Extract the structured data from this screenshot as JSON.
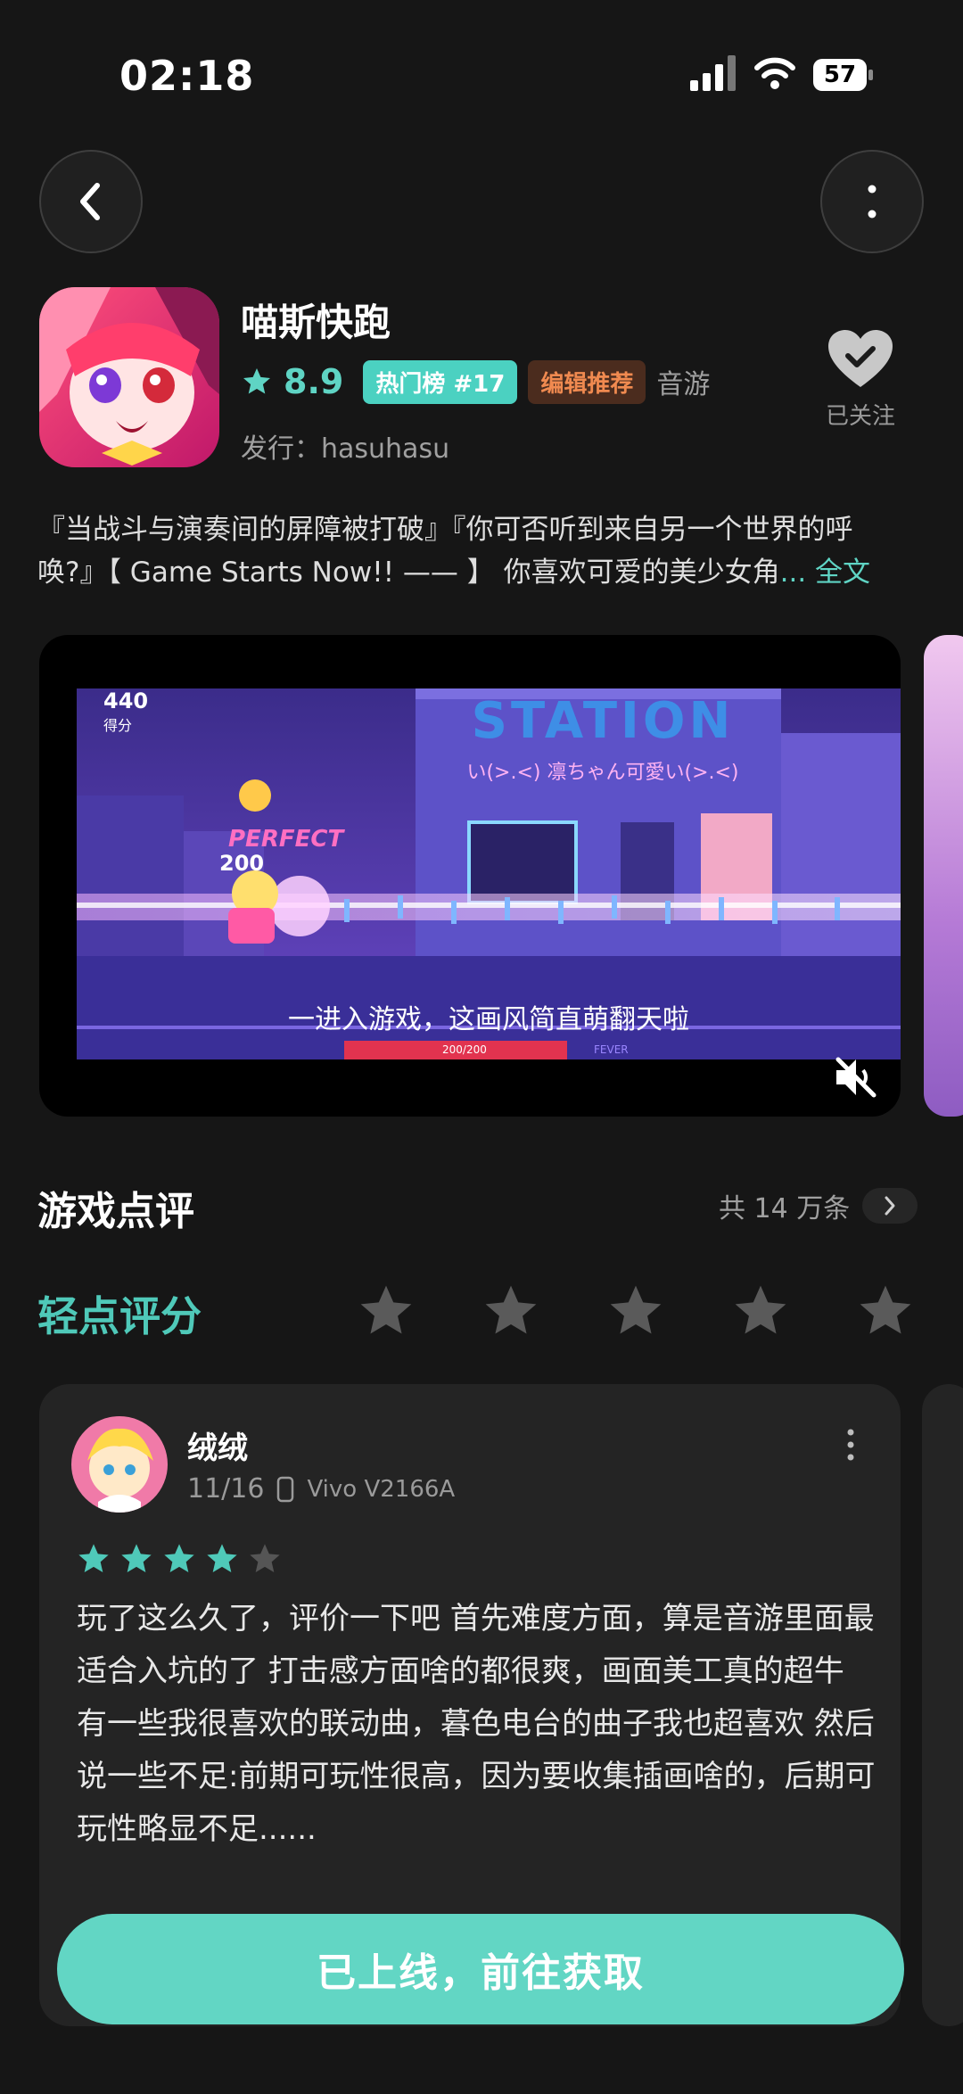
{
  "status_bar": {
    "time": "02:18",
    "battery": "57"
  },
  "header": {
    "back_icon": "chevron-left-icon",
    "more_icon": "vertical-dots-icon"
  },
  "app": {
    "title": "喵斯快跑",
    "score": "8.9",
    "rank_badge": "热门榜 #17",
    "editor_badge": "编辑推荐",
    "genre": "音游",
    "publisher": "发行：hasuhasu",
    "follow_label": "已关注",
    "description_line1": "『当战斗与演奏间的屏障被打破』『你可否听到来自另一个世界的呼",
    "description_line2": "唤?』【 Game Starts Now!! —— 】  你喜欢可爱的美少女角",
    "description_more": "... 全文"
  },
  "video": {
    "score": "440",
    "score_label": "得分",
    "station_sign": "STATION",
    "station_sub": "い(>.<) 凛ちゃん可愛い(>.<)",
    "perfect": "PERFECT",
    "combo": "200",
    "subtitle": "一进入游戏，这画风简直萌翻天啦",
    "hp": "200/200",
    "fever": "FEVER",
    "mute_icon": "speaker-muted-icon"
  },
  "reviews": {
    "section_title": "游戏点评",
    "total": "共 14 万条",
    "tap_rate_label": "轻点评分",
    "review": {
      "name": "绒绒",
      "date": "11/16",
      "device": "Vivo V2166A",
      "stars": 4,
      "text": "玩了这么久了，评价一下吧 首先难度方面，算是音游里面最适合入坑的了 打击感方面啥的都很爽，画面美工真的超牛 有一些我很喜欢的联动曲，暮色电台的曲子我也超喜欢 然后说一些不足:前期可玩性很高，因为要收集插画啥的，后期可玩性略显不足......"
    }
  },
  "cta": {
    "label": "已上线，前往获取"
  },
  "colors": {
    "accent": "#5fd4c4",
    "background": "#161616",
    "card": "#242424",
    "editor_badge": "#f08a50"
  }
}
